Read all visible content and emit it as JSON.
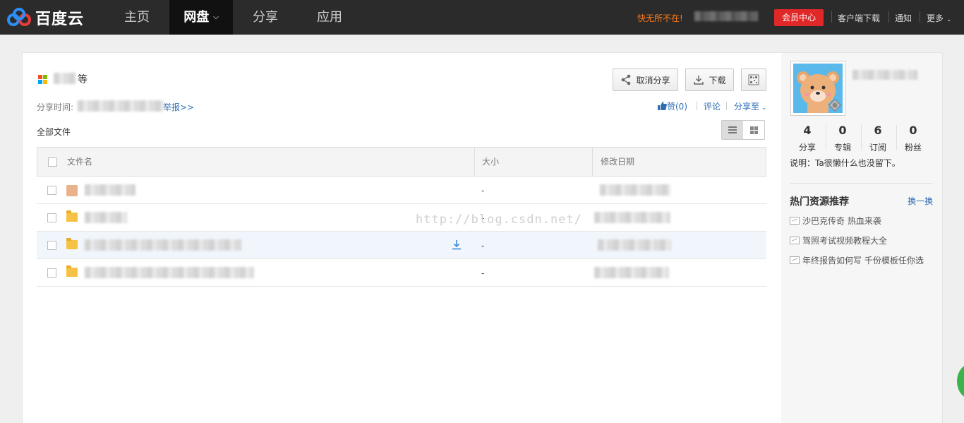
{
  "header": {
    "logo_text": "百度云",
    "nav": [
      {
        "label": "主页"
      },
      {
        "label": "网盘",
        "active": true
      },
      {
        "label": "分享"
      },
      {
        "label": "应用"
      }
    ],
    "promo_text": "快无所不在!",
    "vip_label": "会员中心",
    "links": [
      "客户端下载",
      "通知",
      "更多"
    ]
  },
  "share": {
    "title_suffix": "等",
    "share_time_label": "分享时间:",
    "report_label": "举报>>",
    "buttons": {
      "cancel_share": "取消分享",
      "download": "下载"
    },
    "like_label": "赞(0)",
    "comment_label": "评论",
    "share_to_label": "分享至"
  },
  "file_list": {
    "breadcrumb": "全部文件",
    "columns": [
      "文件名",
      "大小",
      "修改日期"
    ],
    "rows": [
      {
        "size": "-",
        "type": "image"
      },
      {
        "size": "-",
        "type": "folder"
      },
      {
        "size": "-",
        "type": "folder"
      },
      {
        "size": "-",
        "type": "folder"
      }
    ]
  },
  "watermark": "http://blog.csdn.net/",
  "sidebar": {
    "stats": [
      {
        "num": "4",
        "label": "分享"
      },
      {
        "num": "0",
        "label": "专辑"
      },
      {
        "num": "6",
        "label": "订阅"
      },
      {
        "num": "0",
        "label": "粉丝"
      }
    ],
    "description": "说明：Ta很懒什么也没留下。",
    "hot_title": "热门资源推荐",
    "refresh_label": "换一换",
    "recommendations": [
      "沙巴克传奇 热血来袭",
      "驾照考试视频教程大全",
      "年终报告如何写 千份模板任你选"
    ]
  },
  "colors": {
    "topbar": "#2b2b2b",
    "accent_link": "#2e6db4",
    "vip": "#e02828",
    "promo": "#ff7a19"
  }
}
